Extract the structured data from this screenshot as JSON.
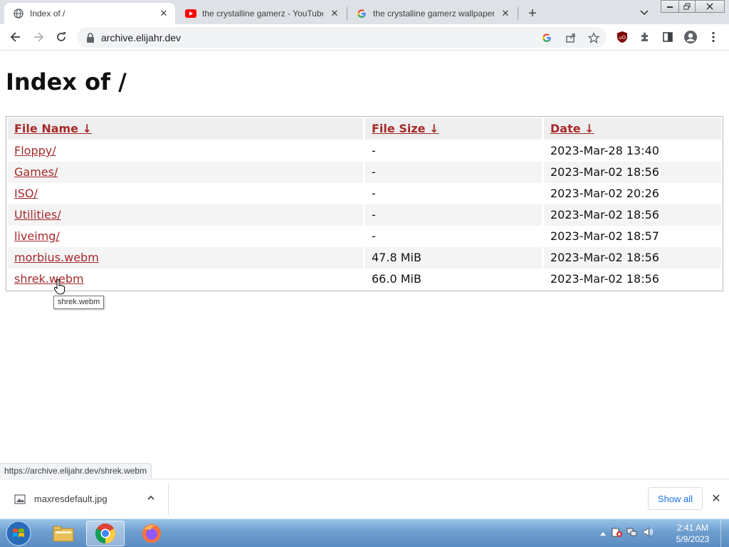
{
  "browser": {
    "tabs": [
      {
        "title": "Index of /",
        "favicon": "globe-icon",
        "active": true
      },
      {
        "title": "the crystalline gamerz - YouTube",
        "favicon": "youtube-icon",
        "active": false
      },
      {
        "title": "the crystalline gamerz wallpaper",
        "favicon": "google-icon",
        "active": false
      }
    ],
    "new_tab_label": "+",
    "url": "archive.elijahr.dev"
  },
  "page": {
    "title": "Index of /",
    "headers": {
      "name": "File Name  ↓",
      "size": "File Size  ↓",
      "date": "Date  ↓"
    },
    "rows": [
      {
        "name": "Floppy/",
        "size": "-",
        "date": "2023-Mar-28 13:40"
      },
      {
        "name": "Games/",
        "size": "-",
        "date": "2023-Mar-02 18:56"
      },
      {
        "name": "ISO/",
        "size": "-",
        "date": "2023-Mar-02 20:26"
      },
      {
        "name": "Utilities/",
        "size": "-",
        "date": "2023-Mar-02 18:56"
      },
      {
        "name": "liveimg/",
        "size": "-",
        "date": "2023-Mar-02 18:57"
      },
      {
        "name": "morbius.webm",
        "size": "47.8 MiB",
        "date": "2023-Mar-02 18:56"
      },
      {
        "name": "shrek.webm",
        "size": "66.0 MiB",
        "date": "2023-Mar-02 18:56"
      }
    ],
    "tooltip": "shrek.webm",
    "status_url": "https://archive.elijahr.dev/shrek.webm"
  },
  "downloads": {
    "file": "maxresdefault.jpg",
    "show_all": "Show all"
  },
  "taskbar": {
    "time": "2:41 AM",
    "date": "5/9/2023"
  },
  "colors": {
    "link": "#a52a2a",
    "taskbar": "#6f9fcf",
    "accent": "#1a73e8"
  }
}
